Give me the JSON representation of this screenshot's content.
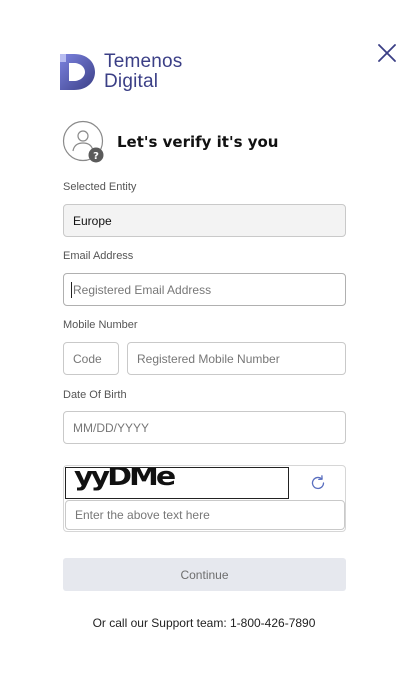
{
  "header": {
    "close_icon": "close-icon",
    "logo": {
      "line1": "Temenos",
      "line2": "Digital",
      "brand_color": "#3b3f86"
    }
  },
  "verify": {
    "title": "Let's verify it's you",
    "avatar_icon": "user-question-icon"
  },
  "form": {
    "entity": {
      "label": "Selected Entity",
      "value": "Europe"
    },
    "email": {
      "label": "Email Address",
      "placeholder": "Registered Email Address"
    },
    "mobile": {
      "label": "Mobile Number",
      "code_placeholder": "Code",
      "number_placeholder": "Registered Mobile Number"
    },
    "dob": {
      "label": "Date Of Birth",
      "placeholder": "MM/DD/YYYY"
    },
    "captcha": {
      "image_text": "yyDMe",
      "refresh_icon": "refresh-icon",
      "input_placeholder": "Enter the above text here"
    }
  },
  "actions": {
    "continue_label": "Continue"
  },
  "footer": {
    "support_text": "Or call our Support team: 1-800-426-7890"
  }
}
